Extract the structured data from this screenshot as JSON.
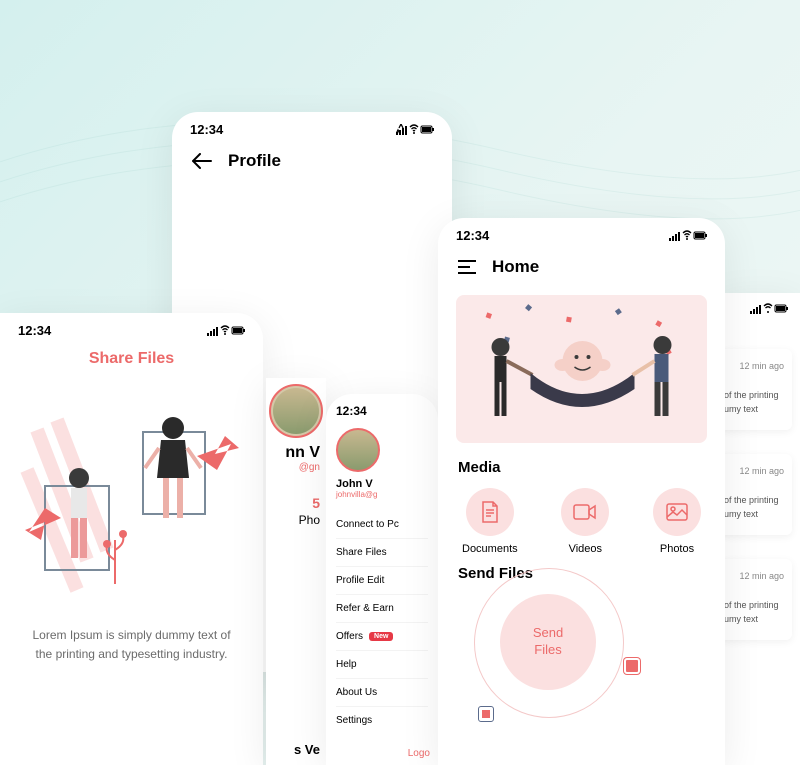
{
  "colors": {
    "accent": "#ec6a6a",
    "bg_soft": "#fbe9e9",
    "circle": "#fbe0e0",
    "badge": "#e63946"
  },
  "status_time": "12:34",
  "profile": {
    "title": "Profile"
  },
  "share": {
    "title": "Share Files",
    "desc": "Lorem Ipsum is simply dummy text of the printing and typesetting industry."
  },
  "avatar_snippet": {
    "name_frag": "nn V",
    "email_frag": "@gn",
    "stat_num": "5",
    "stat_label": "Pho",
    "bottom_frag": "s Ve"
  },
  "menu": {
    "name": "John V",
    "email": "johnvilla@g",
    "items": [
      {
        "label": "Connect to Pc"
      },
      {
        "label": "Share Files"
      },
      {
        "label": "Profile Edit"
      },
      {
        "label": "Refer & Earn"
      },
      {
        "label": "Offers",
        "badge": "New"
      },
      {
        "label": "Help"
      },
      {
        "label": "About Us"
      },
      {
        "label": "Settings"
      }
    ],
    "logout": "Logo"
  },
  "home": {
    "title": "Home",
    "media_title": "Media",
    "media": [
      {
        "label": "Documents",
        "icon": "document-icon"
      },
      {
        "label": "Videos",
        "icon": "video-icon"
      },
      {
        "label": "Photos",
        "icon": "photo-icon"
      }
    ],
    "send_title": "Send Files",
    "send_button": "Send\nFiles"
  },
  "notifications": {
    "items": [
      {
        "time": "12 min ago",
        "text": "of the printing umy text"
      },
      {
        "time": "12 min ago",
        "text": "of the printing umy text"
      },
      {
        "time": "12 min ago",
        "text": "of the printing umy text"
      }
    ]
  }
}
